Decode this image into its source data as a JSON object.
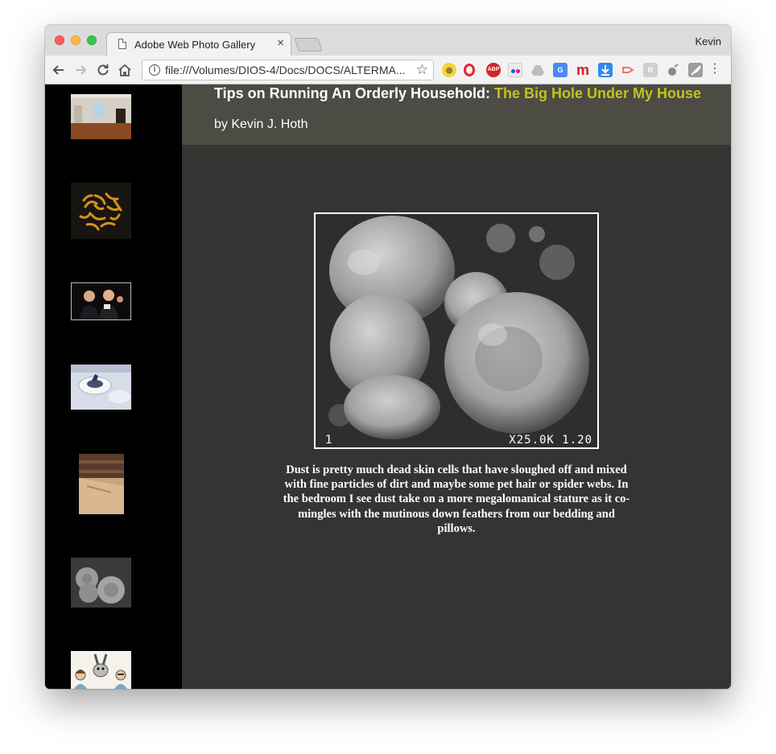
{
  "browser": {
    "tab_title": "Adobe Web Photo Gallery",
    "tab_close": "×",
    "profile_name": "Kevin",
    "url": "file:///Volumes/DIOS-4/Docs/DOCS/ALTERMA...",
    "extensions": [
      "glasses-extension-icon",
      "opera-extension-icon",
      "adblock-extension-icon",
      "flickr-extension-icon",
      "drive-extension-icon",
      "translate-extension-icon",
      "m-extension-icon",
      "download-extension-icon",
      "arrow-extension-icon",
      "r-extension-icon",
      "satellite-extension-icon",
      "feather-extension-icon"
    ],
    "ext_labels": {
      "abp": "ABP",
      "m": "m",
      "r": "R"
    }
  },
  "page": {
    "title_prefix": "Tips on Running An Orderly Household: ",
    "title_highlight": "The Big Hole Under My House",
    "byline": "by Kevin J. Hoth",
    "photo_scale_left": "1",
    "photo_scale_right": "X25.0K 1.20",
    "caption": "Dust is pretty much dead skin cells that have sloughed off and mixed with fine particles of dirt and maybe some pet hair or spider webs. In the bedroom I see dust take on a more megalomanical stature as it co-mingles with the mutinous down feathers from our bedding and pillows."
  },
  "colors": {
    "sidebar": "#000000",
    "content_bg": "#353432",
    "header_bg": "#4c4b44",
    "title_highlight": "#c4c21b"
  },
  "sidebar_thumbnails": [
    "room-thumbnail",
    "worms-thumbnail",
    "people-thumbnail",
    "snow-hole-thumbnail",
    "brick-corner-thumbnail",
    "dust-thumbnail",
    "bunny-cartoon-thumbnail"
  ]
}
